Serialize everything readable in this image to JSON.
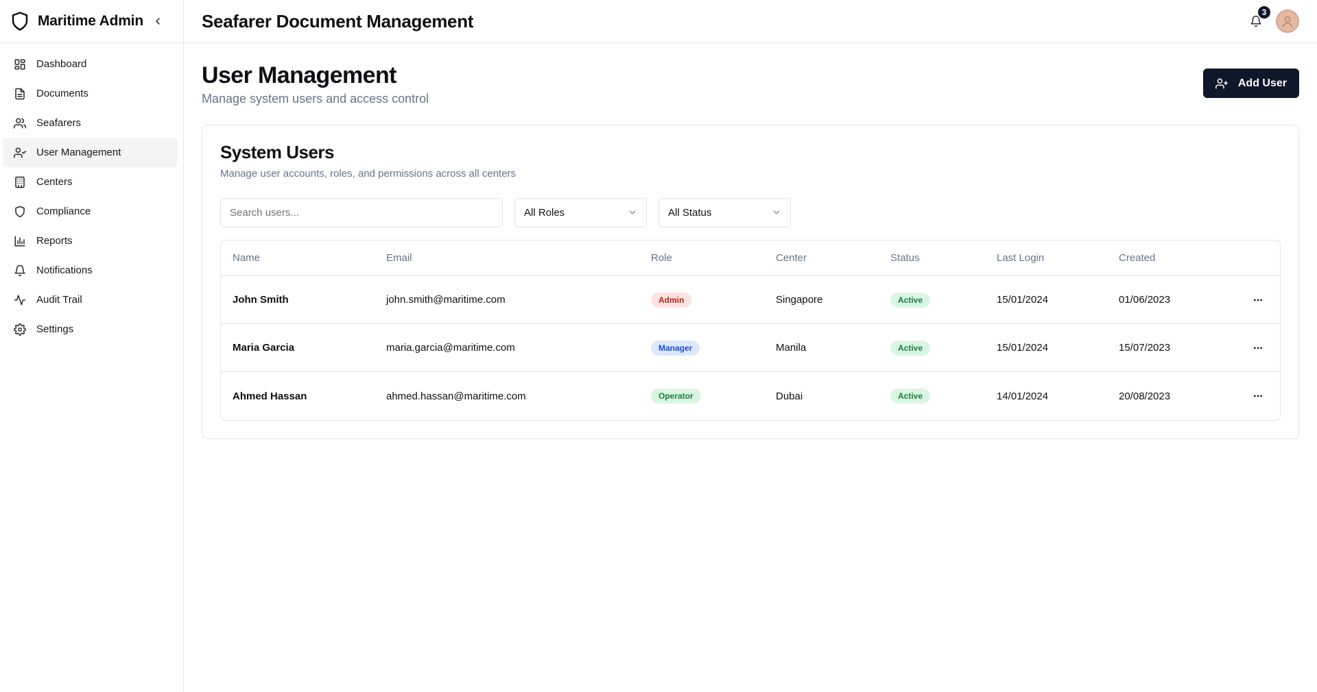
{
  "sidebar": {
    "brand": "Maritime Admin",
    "items": [
      {
        "label": "Dashboard",
        "icon": "dashboard-icon"
      },
      {
        "label": "Documents",
        "icon": "document-icon"
      },
      {
        "label": "Seafarers",
        "icon": "users-icon"
      },
      {
        "label": "User Management",
        "icon": "user-check-icon",
        "active": true
      },
      {
        "label": "Centers",
        "icon": "building-icon"
      },
      {
        "label": "Compliance",
        "icon": "shield-icon"
      },
      {
        "label": "Reports",
        "icon": "bar-chart-icon"
      },
      {
        "label": "Notifications",
        "icon": "bell-icon"
      },
      {
        "label": "Audit Trail",
        "icon": "activity-icon"
      },
      {
        "label": "Settings",
        "icon": "gear-icon"
      }
    ]
  },
  "header": {
    "title": "Seafarer Document Management",
    "notification_count": "3"
  },
  "page": {
    "title": "User Management",
    "subtitle": "Manage system users and access control",
    "add_button": "Add User"
  },
  "card": {
    "title": "System Users",
    "subtitle": "Manage user accounts, roles, and permissions across all centers"
  },
  "filters": {
    "search_placeholder": "Search users...",
    "search_value": "",
    "role": "All Roles",
    "status": "All Status"
  },
  "table": {
    "columns": [
      "Name",
      "Email",
      "Role",
      "Center",
      "Status",
      "Last Login",
      "Created"
    ],
    "rows": [
      {
        "name": "John Smith",
        "email": "john.smith@maritime.com",
        "role": "Admin",
        "center": "Singapore",
        "status": "Active",
        "last_login": "15/01/2024",
        "created": "01/06/2023"
      },
      {
        "name": "Maria Garcia",
        "email": "maria.garcia@maritime.com",
        "role": "Manager",
        "center": "Manila",
        "status": "Active",
        "last_login": "15/01/2024",
        "created": "15/07/2023"
      },
      {
        "name": "Ahmed Hassan",
        "email": "ahmed.hassan@maritime.com",
        "role": "Operator",
        "center": "Dubai",
        "status": "Active",
        "last_login": "14/01/2024",
        "created": "20/08/2023"
      }
    ]
  },
  "colors": {
    "primary": "#0f172a",
    "admin_bg": "#fde2e2",
    "admin_fg": "#b42318",
    "manager_bg": "#dbe8fb",
    "manager_fg": "#1d4ed8",
    "operator_bg": "#dcf5e3",
    "operator_fg": "#15803d",
    "active_bg": "#dcf5e3",
    "active_fg": "#15803d"
  }
}
